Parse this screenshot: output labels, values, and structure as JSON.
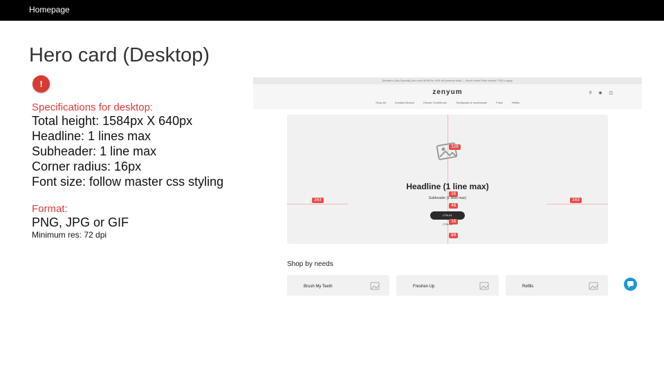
{
  "topbar": {
    "title": "Homepage"
  },
  "slide": {
    "title": "Hero card (Desktop)"
  },
  "specs": {
    "heading": "Specifications for desktop:",
    "lines": [
      "Total height: 1584px X 640px",
      "Headline: 1 lines max",
      "Subheader: 1 line max",
      "Corner radius: 16px",
      "Font size: follow master css styling"
    ]
  },
  "format": {
    "heading": "Format:",
    "types": "PNG, JPG or GIF",
    "resolution": "Minimum res: 72 dpi"
  },
  "mockup": {
    "promo": "[Mother's Day Special] Use code MOM for 40% off [amount limit] — Brush Head Pack bundle *T&Cs apply",
    "logo": "zenyum",
    "nav_links": [
      "Shop All",
      "Invisible Braces",
      "Electric Toothbrush",
      "Toothpaste & mouthwash",
      "Floss",
      "Refills"
    ],
    "hero": {
      "headline": "Headline (1 line max)",
      "subheader": "Subheader (1 lines max)",
      "cta": "CTA-01",
      "cta_below": "CTA-02",
      "measurements": {
        "image_top": "320",
        "left": "303",
        "right": "303",
        "headline_gap": "16",
        "subheader_gap": "48",
        "cta_gap": "16",
        "bottom": "80"
      }
    },
    "shop": {
      "title": "Shop by needs",
      "cards": [
        "Brush My Teeth",
        "Freshen Up",
        "Refills"
      ]
    }
  },
  "colors": {
    "accent_red": "#e03a3a",
    "alert": "#d83b33",
    "chat": "#1a98d5",
    "topbar": "#000000"
  }
}
